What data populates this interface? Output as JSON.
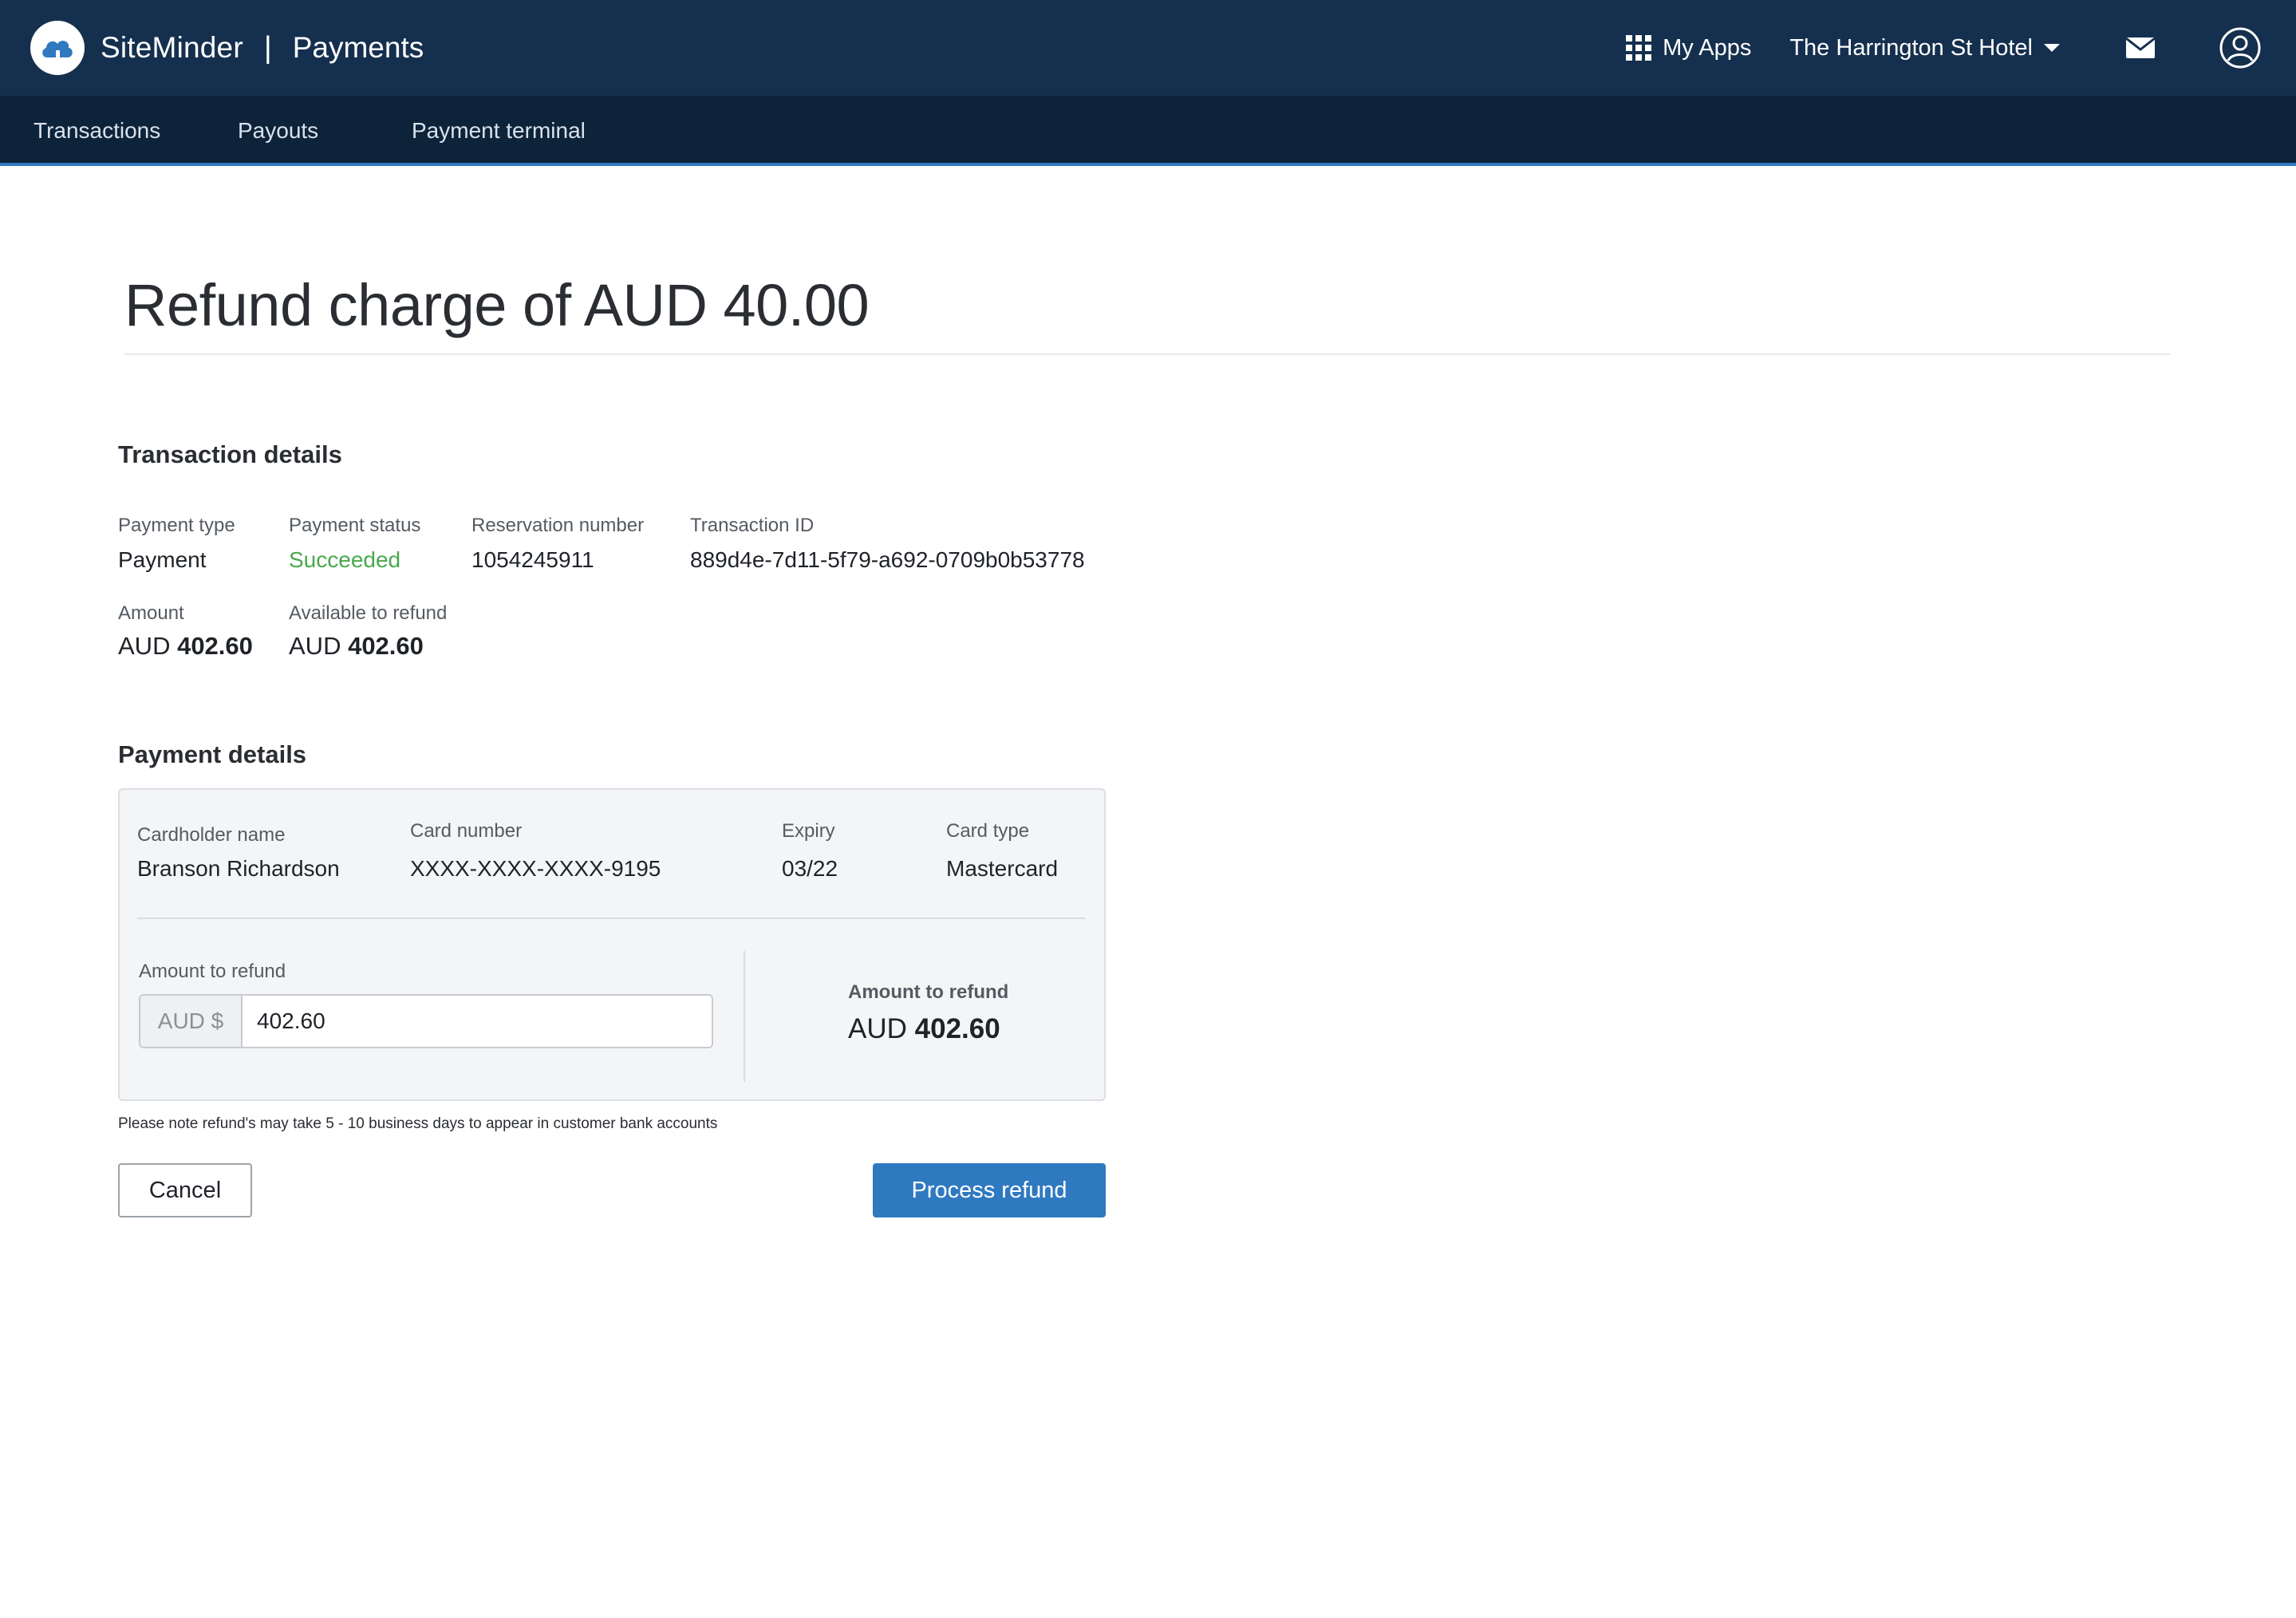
{
  "header": {
    "brand_name": "SiteMinder",
    "separator": "|",
    "product": "Payments",
    "my_apps": "My Apps",
    "property_name": "The Harrington St Hotel",
    "colors": {
      "bar": "#15304e",
      "subnav": "#0c233a",
      "accent": "#2f79c0"
    },
    "icons": [
      "siteminder-logo-icon",
      "apps-grid-icon",
      "chevron-down-icon",
      "mail-icon",
      "user-icon"
    ]
  },
  "subnav": {
    "items": [
      "Transactions",
      "Payouts",
      "Payment terminal"
    ]
  },
  "page": {
    "title": "Refund charge of AUD 40.00"
  },
  "transaction_details": {
    "heading": "Transaction details",
    "payment_type_label": "Payment type",
    "payment_type": "Payment",
    "payment_status_label": "Payment status",
    "payment_status": "Succeeded",
    "reservation_number_label": "Reservation number",
    "reservation_number": "1054245911",
    "transaction_id_label": "Transaction ID",
    "transaction_id": "889d4e-7d11-5f79-a692-0709b0b53778",
    "amount_label": "Amount",
    "amount_currency": "AUD",
    "amount_value": "402.60",
    "available_label": "Available to refund",
    "available_currency": "AUD",
    "available_value": "402.60",
    "status_color": "#4aa84e"
  },
  "payment_details": {
    "heading": "Payment details",
    "cardholder_label": "Cardholder name",
    "cardholder": "Branson Richardson",
    "card_number_label": "Card number",
    "card_number": "XXXX-XXXX-XXXX-9195",
    "expiry_label": "Expiry",
    "expiry": "03/22",
    "card_type_label": "Card type",
    "card_type": "Mastercard",
    "refund_input_label": "Amount to refund",
    "refund_prefix": "AUD $",
    "refund_input_value": "402.60",
    "summary_label": "Amount to refund",
    "summary_currency": "AUD",
    "summary_value": "402.60"
  },
  "note": "Please note refund's may take 5 - 10 business days to appear in customer bank accounts",
  "actions": {
    "cancel": "Cancel",
    "process": "Process refund"
  }
}
